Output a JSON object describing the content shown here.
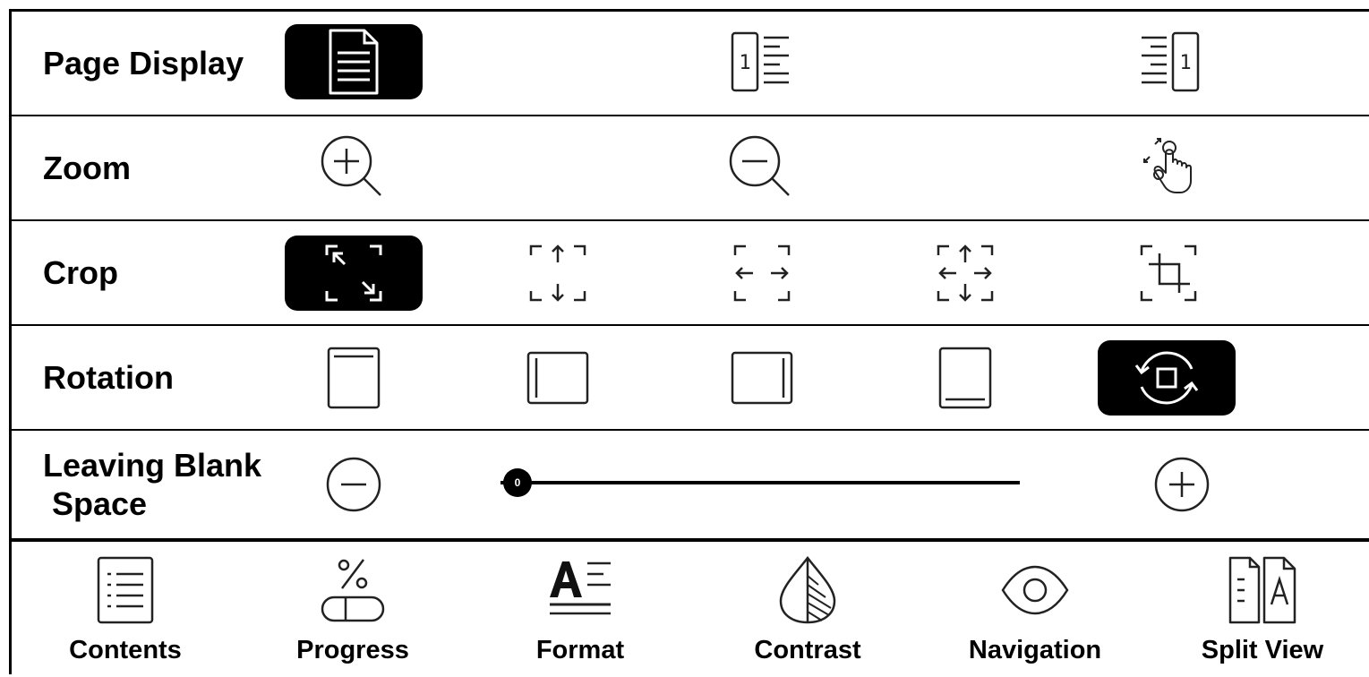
{
  "rows": {
    "page_display": {
      "label": "Page Display",
      "selected": "single-page"
    },
    "zoom": {
      "label": "Zoom"
    },
    "crop": {
      "label": "Crop",
      "selected": "auto-crop"
    },
    "rotation": {
      "label": "Rotation",
      "selected": "auto-rotate"
    },
    "blank_space": {
      "label_line1": "Leaving Blank",
      "label_line2": "Space",
      "value": "0"
    }
  },
  "page_display_icons": [
    "single-page-icon",
    "page-number-left-icon",
    "page-number-right-icon"
  ],
  "zoom_icons": [
    "zoom-in-icon",
    "zoom-out-icon",
    "pinch-zoom-icon"
  ],
  "crop_icons": [
    "auto-crop-icon",
    "crop-vertical-icon",
    "crop-horizontal-icon",
    "crop-both-icon",
    "manual-crop-icon"
  ],
  "rotation_icons": [
    "rotate-top-icon",
    "rotate-left-icon",
    "rotate-right-icon",
    "rotate-bottom-icon",
    "auto-rotate-icon"
  ],
  "bottom_nav": [
    {
      "label": "Contents",
      "icon": "contents-icon"
    },
    {
      "label": "Progress",
      "icon": "progress-icon"
    },
    {
      "label": "Format",
      "icon": "format-icon"
    },
    {
      "label": "Contrast",
      "icon": "contrast-icon"
    },
    {
      "label": "Navigation",
      "icon": "navigation-icon"
    },
    {
      "label": "Split View",
      "icon": "split-view-icon"
    }
  ],
  "colors": {
    "foreground": "#000000",
    "background": "#ffffff"
  }
}
